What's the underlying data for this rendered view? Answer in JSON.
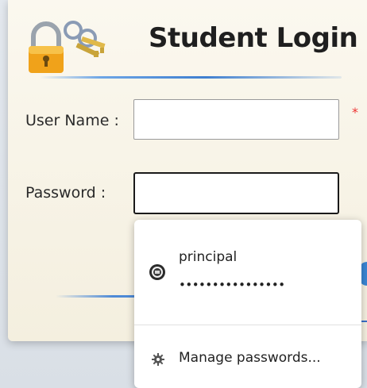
{
  "login": {
    "title": "Student Login",
    "user_label": "User Name :",
    "password_label": "Password :",
    "user_value": "",
    "password_value": "",
    "required_marker": "*"
  },
  "autofill": {
    "saved_username": "principal",
    "saved_password_mask": "••••••••••••••••",
    "manage_label": "Manage passwords..."
  },
  "icons": {
    "logo": "lock-with-keys-icon",
    "site": "site-favicon-icon",
    "manage": "gear-icon"
  },
  "colors": {
    "accent": "#3f7fd0",
    "required": "#e33333",
    "card_bg": "#f8f4e8"
  }
}
